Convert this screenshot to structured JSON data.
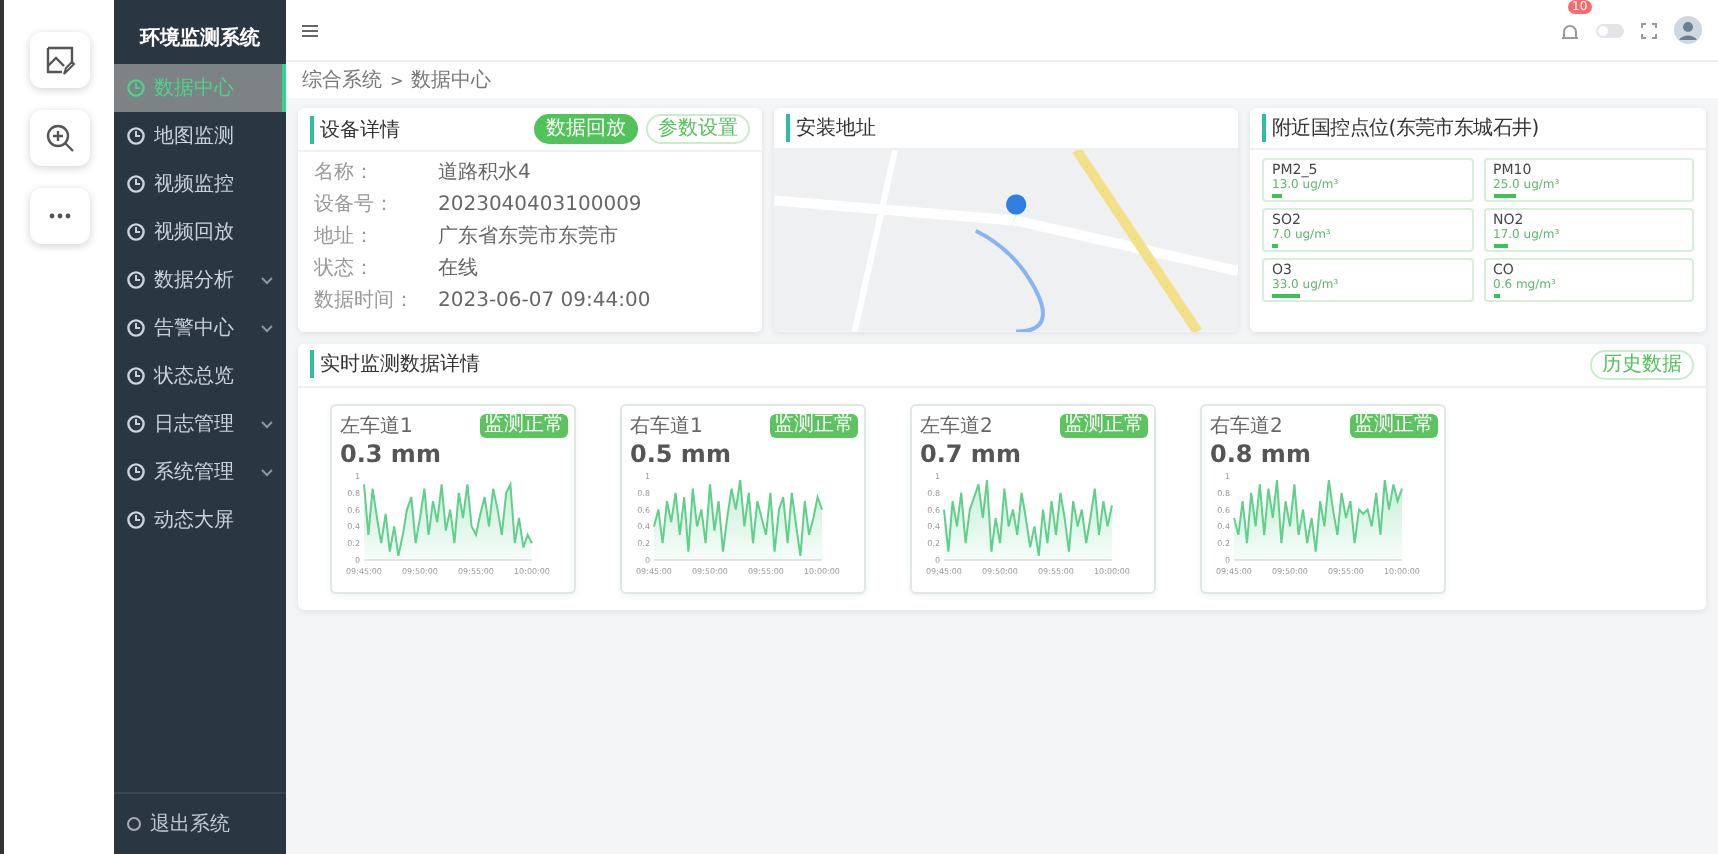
{
  "sidebar": {
    "title": "环境监测系统",
    "items": [
      {
        "label": "数据中心",
        "selected": true,
        "has_submenu": false
      },
      {
        "label": "地图监测",
        "selected": false,
        "has_submenu": false
      },
      {
        "label": "视频监控",
        "selected": false,
        "has_submenu": false
      },
      {
        "label": "视频回放",
        "selected": false,
        "has_submenu": false
      },
      {
        "label": "数据分析",
        "selected": false,
        "has_submenu": true
      },
      {
        "label": "告警中心",
        "selected": false,
        "has_submenu": true
      },
      {
        "label": "状态总览",
        "selected": false,
        "has_submenu": false
      },
      {
        "label": "日志管理",
        "selected": false,
        "has_submenu": true
      },
      {
        "label": "系统管理",
        "selected": false,
        "has_submenu": true
      },
      {
        "label": "动态大屏",
        "selected": false,
        "has_submenu": false
      }
    ],
    "logout": "退出系统"
  },
  "header": {
    "notification_count": "10",
    "theme_switch": {
      "on": false
    }
  },
  "breadcrumb": [
    "综合系统",
    "数据中心"
  ],
  "breadcrumb_separator": ">",
  "device": {
    "title": "设备详情",
    "buttons": [
      {
        "label": "数据回放",
        "kind": "primary"
      },
      {
        "label": "参数设置",
        "kind": "outline"
      }
    ],
    "fields": [
      {
        "label": "名称：",
        "value": "道路积水4"
      },
      {
        "label": "设备号：",
        "value": "2023040403100009"
      },
      {
        "label": "地址：",
        "value": "广东省东莞市东莞市"
      },
      {
        "label": "状态：",
        "value": "在线"
      },
      {
        "label": "数据时间：",
        "value": "2023-06-07 09:44:00"
      }
    ]
  },
  "map": {
    "title": "安装地址"
  },
  "air": {
    "title": "附近国控点位(东莞市东城石井)",
    "items": [
      {
        "name": "PM2_5",
        "reading": "13.0 ug/m³",
        "level": 0.05
      },
      {
        "name": "PM10",
        "reading": "25.0 ug/m³",
        "level": 0.12
      },
      {
        "name": "SO2",
        "reading": "7.0 ug/m³",
        "level": 0.03
      },
      {
        "name": "NO2",
        "reading": "17.0 ug/m³",
        "level": 0.08
      },
      {
        "name": "O3",
        "reading": "33.0 ug/m³",
        "level": 0.15
      },
      {
        "name": "CO",
        "reading": "0.6 mg/m³",
        "level": 0.04
      }
    ]
  },
  "realtime": {
    "title": "实时监测数据详情",
    "history_button": "历史数据",
    "cards": [
      {
        "name": "左车道1",
        "value": "0.3 mm",
        "status": "监测正常",
        "axis_labels": [
          "09:45:00",
          "09:50:00",
          "09:55:00",
          "10:00:00"
        ],
        "chart_data": {
          "type": "area",
          "yticks": [
            0,
            0.2,
            0.4,
            0.6,
            0.8,
            1
          ],
          "ylim": [
            0,
            1
          ],
          "series": [
            {
              "color": "#5fd08a",
              "values": [
                0.9,
                0.3,
                0.85,
                0.5,
                0.2,
                0.55,
                0.1,
                0.4,
                0.05,
                0.3,
                0.6,
                0.75,
                0.2,
                0.5,
                0.85,
                0.3,
                0.7,
                0.45,
                0.9,
                0.35,
                0.6,
                0.2,
                0.8,
                0.5,
                0.9,
                0.4,
                0.3,
                0.55,
                0.75,
                0.4,
                0.85,
                0.6,
                0.3,
                0.8,
                0.9,
                0.2,
                0.5,
                0.15,
                0.3,
                0.2
              ]
            }
          ]
        }
      },
      {
        "name": "右车道1",
        "value": "0.5 mm",
        "status": "监测正常",
        "axis_labels": [
          "09:45:00",
          "09:50:00",
          "09:55:00",
          "10:00:00"
        ],
        "chart_data": {
          "type": "area",
          "yticks": [
            0,
            0.2,
            0.4,
            0.6,
            0.8,
            1
          ],
          "ylim": [
            0,
            1
          ],
          "series": [
            {
              "color": "#5fd08a",
              "values": [
                0.4,
                0.6,
                0.2,
                0.7,
                0.45,
                0.8,
                0.3,
                0.75,
                0.1,
                0.85,
                0.4,
                0.6,
                0.2,
                0.9,
                0.35,
                0.7,
                0.1,
                0.5,
                0.85,
                0.6,
                0.95,
                0.4,
                0.8,
                0.2,
                0.7,
                0.5,
                0.3,
                0.8,
                0.1,
                0.6,
                0.75,
                0.2,
                0.8,
                0.4,
                0.05,
                0.7,
                0.3,
                0.5,
                0.75,
                0.6
              ]
            }
          ]
        }
      },
      {
        "name": "左车道2",
        "value": "0.7 mm",
        "status": "监测正常",
        "axis_labels": [
          "09:45:00",
          "09:50:00",
          "09:55:00",
          "10:00:00"
        ],
        "chart_data": {
          "type": "area",
          "yticks": [
            0,
            0.2,
            0.4,
            0.6,
            0.8,
            1
          ],
          "ylim": [
            0,
            1
          ],
          "series": [
            {
              "color": "#5fd08a",
              "values": [
                0.6,
                0.1,
                0.7,
                0.4,
                0.8,
                0.2,
                0.6,
                0.75,
                0.9,
                0.5,
                0.95,
                0.1,
                0.5,
                0.2,
                0.85,
                0.4,
                0.6,
                0.3,
                0.8,
                0.5,
                0.15,
                0.4,
                0.05,
                0.6,
                0.2,
                0.7,
                0.3,
                0.8,
                0.5,
                0.1,
                0.7,
                0.4,
                0.6,
                0.2,
                0.5,
                0.85,
                0.3,
                0.7,
                0.4,
                0.65
              ]
            }
          ]
        }
      },
      {
        "name": "右车道2",
        "value": "0.8 mm",
        "status": "监测正常",
        "axis_labels": [
          "09:45:00",
          "09:50:00",
          "09:55:00",
          "10:00:00"
        ],
        "chart_data": {
          "type": "area",
          "yticks": [
            0,
            0.2,
            0.4,
            0.6,
            0.8,
            1
          ],
          "ylim": [
            0,
            1
          ],
          "series": [
            {
              "color": "#5fd08a",
              "values": [
                0.5,
                0.3,
                0.7,
                0.2,
                0.8,
                0.4,
                0.9,
                0.3,
                0.85,
                0.5,
                0.95,
                0.2,
                0.7,
                0.4,
                0.9,
                0.3,
                0.6,
                0.2,
                0.5,
                0.1,
                0.7,
                0.4,
                0.95,
                0.6,
                0.3,
                0.8,
                0.5,
                0.7,
                0.2,
                0.6,
                0.55,
                0.6,
                0.4,
                0.8,
                0.3,
                0.95,
                0.6,
                0.9,
                0.7,
                0.85
              ]
            }
          ]
        }
      }
    ]
  }
}
